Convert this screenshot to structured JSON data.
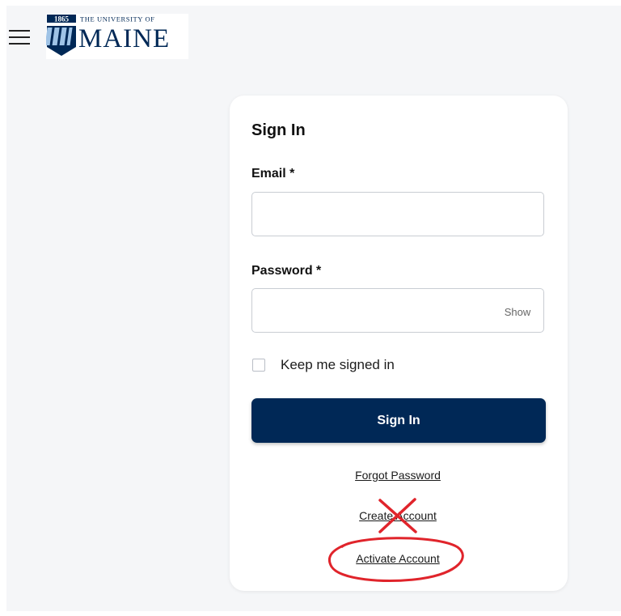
{
  "header": {
    "menu_icon": "hamburger-menu-icon",
    "logo": {
      "year": "1865",
      "tagline": "THE UNIVERSITY OF",
      "name": "MAINE",
      "colors": {
        "navy": "#002856",
        "light_blue": "#9fc3e6"
      }
    }
  },
  "signin_card": {
    "title": "Sign In",
    "email": {
      "label": "Email *",
      "value": "",
      "placeholder": ""
    },
    "password": {
      "label": "Password *",
      "value": "",
      "placeholder": "",
      "show_label": "Show"
    },
    "keep_signed_in": {
      "label": "Keep me signed in",
      "checked": false
    },
    "submit_label": "Sign In",
    "links": {
      "forgot_password": "Forgot Password",
      "create_account": "Create Account",
      "activate_account": "Activate Account"
    }
  },
  "annotations": {
    "color": "#e0242b",
    "cross_mark": "x-mark-over-create-account",
    "circle_mark": "circle-around-activate-account"
  },
  "colors": {
    "primary_button": "#002856",
    "page_background": "#f5f6f8",
    "card_background": "#ffffff"
  }
}
